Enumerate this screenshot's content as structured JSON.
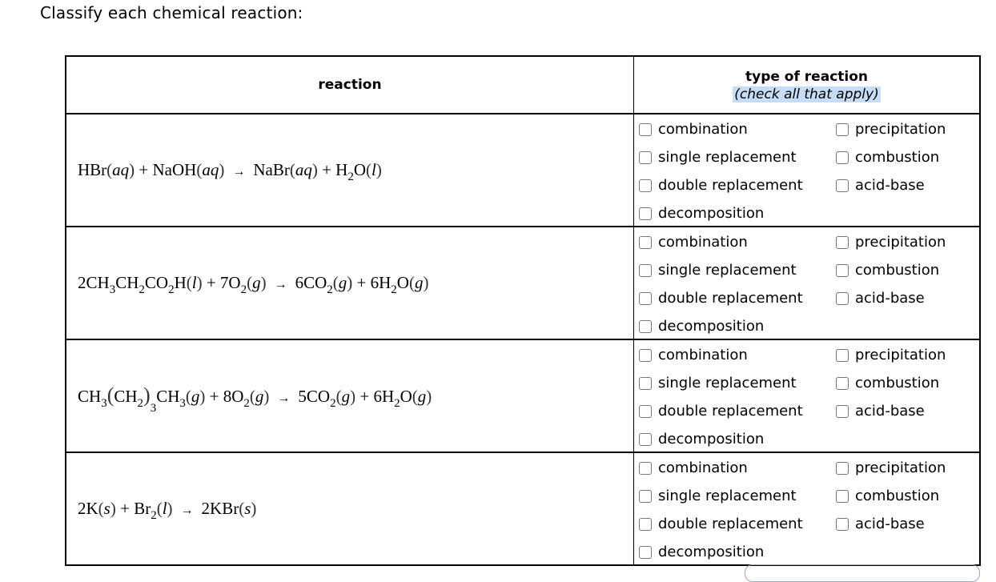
{
  "prompt": "Classify each chemical reaction:",
  "table": {
    "header_reaction": "reaction",
    "header_type": "type of reaction",
    "header_note": "(check all that apply)"
  },
  "options": [
    "combination",
    "single replacement",
    "double replacement",
    "decomposition",
    "precipitation",
    "combustion",
    "acid-base"
  ],
  "rows": [
    {
      "equation_text": "HBr(aq) + NaOH(aq) → NaBr(aq) + H2O(l)",
      "checked": []
    },
    {
      "equation_text": "2CH3CH2CO2H(l) + 7O2(g) → 6CO2(g) + 6H2O(g)",
      "checked": []
    },
    {
      "equation_text": "CH3(CH2)3CH3(g) + 8O2(g) → 5CO2(g) + 6H2O(g)",
      "checked": []
    },
    {
      "equation_text": "2K(s) + Br2(l) → 2KBr(s)",
      "checked": []
    }
  ],
  "colors": {
    "highlight": "#c6dcf7",
    "checkbox_border": "#777777"
  }
}
